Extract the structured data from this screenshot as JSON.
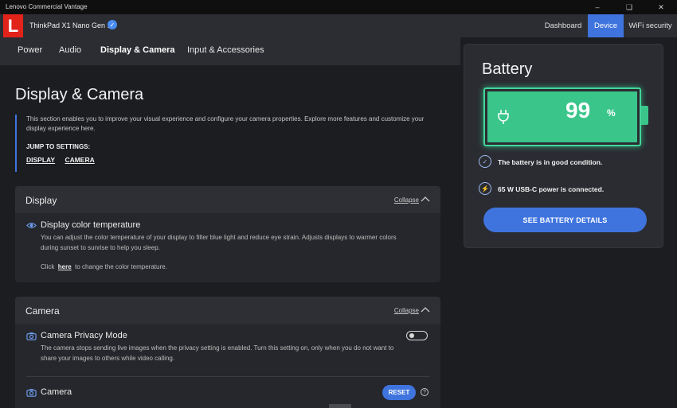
{
  "window": {
    "title": "Lenovo Commercial Vantage"
  },
  "header": {
    "logo_letter": "L",
    "device_name": "ThinkPad X1 Nano Gen 1",
    "nav": [
      {
        "label": "Dashboard",
        "active": false
      },
      {
        "label": "Device",
        "active": true
      },
      {
        "label": "WiFi security",
        "active": false
      }
    ]
  },
  "subnav": {
    "tabs": [
      {
        "label": "Power",
        "active": false
      },
      {
        "label": "Audio",
        "active": false
      },
      {
        "label": "Display & Camera",
        "active": true
      },
      {
        "label": "Input & Accessories",
        "active": false
      }
    ]
  },
  "main": {
    "title": "Display & Camera",
    "description": "This section enables you to improve your visual experience and configure your camera properties. Explore more features and customize your display experience here.",
    "jump_label": "JUMP TO SETTINGS:",
    "jump_links": [
      "DISPLAY",
      "CAMERA"
    ]
  },
  "display_card": {
    "heading": "Display",
    "collapse_label": "Collapse",
    "item_title": "Display color temperature",
    "item_desc": "You can adjust the color temperature of your display to filter blue light and reduce eye strain. Adjusts displays to warmer colors during sunset to sunrise to help you sleep.",
    "click_prefix": "Click",
    "click_link": "here",
    "click_suffix": "to change the color temperature."
  },
  "camera_card": {
    "heading": "Camera",
    "collapse_label": "Collapse",
    "privacy_title": "Camera Privacy Mode",
    "privacy_desc": "The camera stops sending live images when the privacy setting is enabled. Turn this setting on, only when you do not want to share your images to others while video calling.",
    "privacy_toggle_on": false,
    "camera_title": "Camera",
    "reset_label": "RESET"
  },
  "battery": {
    "title": "Battery",
    "percent": "99",
    "percent_sign": "%",
    "status_condition": "The battery is in good condition.",
    "status_power": "65 W USB-C power is connected.",
    "details_button": "SEE BATTERY DETAILS",
    "color": "#3ac58b"
  },
  "colors": {
    "accent": "#3f74de",
    "logo": "#e2231a",
    "battery_green": "#3ac58b"
  }
}
